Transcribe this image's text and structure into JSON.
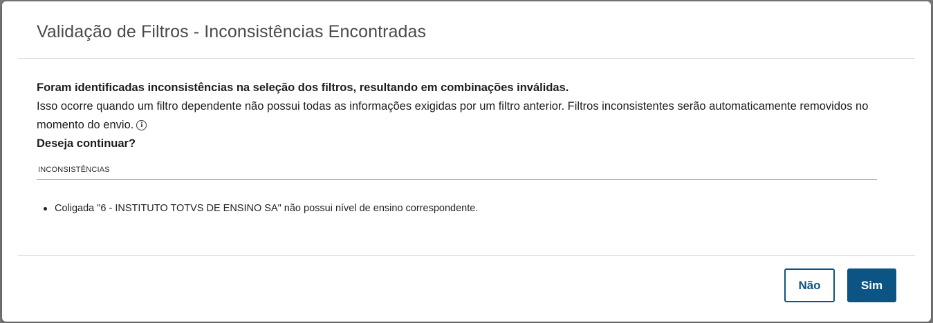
{
  "colors": {
    "primary": "#0c5484",
    "title_text": "#4a4a4a",
    "divider": "#d8d8d8"
  },
  "dialog": {
    "title": "Validação de Filtros - Inconsistências Encontradas",
    "lead": "Foram identificadas inconsistências na seleção dos filtros, resultando em combinações inválidas.",
    "description": "Isso ocorre quando um filtro dependente não possui todas as informações exigidas por um filtro anterior. Filtros inconsistentes serão automaticamente removidos no momento do envio.",
    "info_icon": "info-circle-icon",
    "info_glyph": "i",
    "question": "Deseja continuar?",
    "section_label": "INCONSISTÊNCIAS",
    "issues": [
      "Coligada \"6 - INSTITUTO TOTVS DE ENSINO SA\" não possui nível de ensino correspondente."
    ],
    "buttons": {
      "no_label": "Não",
      "yes_label": "Sim"
    }
  }
}
